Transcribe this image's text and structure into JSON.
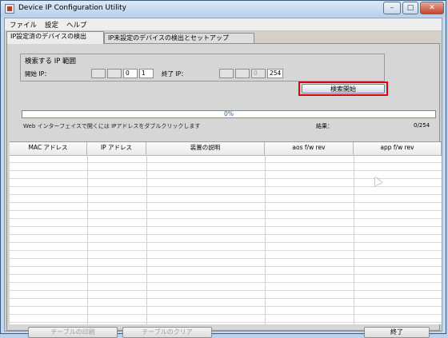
{
  "window": {
    "title": "Device IP Configuration Utility"
  },
  "menu": [
    "ファイル",
    "設定",
    "ヘルプ"
  ],
  "tabs": [
    {
      "label": "IP設定済のデバイスの検出",
      "active": true
    },
    {
      "label": "IP未設定のデバイスの検出とセットアップ",
      "active": false
    }
  ],
  "search_range": {
    "group_title": "検索する IP 範囲",
    "start_label": "開始 IP：",
    "start_octets": [
      "",
      "",
      "0",
      "1"
    ],
    "end_label": "終了 IP：",
    "end_octets": [
      "",
      "",
      "0",
      "254"
    ],
    "search_button": "検索開始",
    "highlight_color": "#e0000b"
  },
  "progress": {
    "percent_text": "0%",
    "value": 0,
    "color": "#3f88d0"
  },
  "hint_text": "Web インターフェイスで開くには IPアドレスをダブルクリックします",
  "result": {
    "label": "結果：",
    "value": "0/254"
  },
  "table": {
    "columns": [
      "MAC アドレス",
      "IP アドレス",
      "装置の説明",
      "aos f/w rev",
      "app f/w rev"
    ]
  },
  "buttons": {
    "print": "テーブルの印刷",
    "clear": "テーブルのクリア",
    "exit": "終了"
  },
  "window_buttons": {
    "minimize": "–",
    "maximize": "□",
    "close": "✕"
  }
}
